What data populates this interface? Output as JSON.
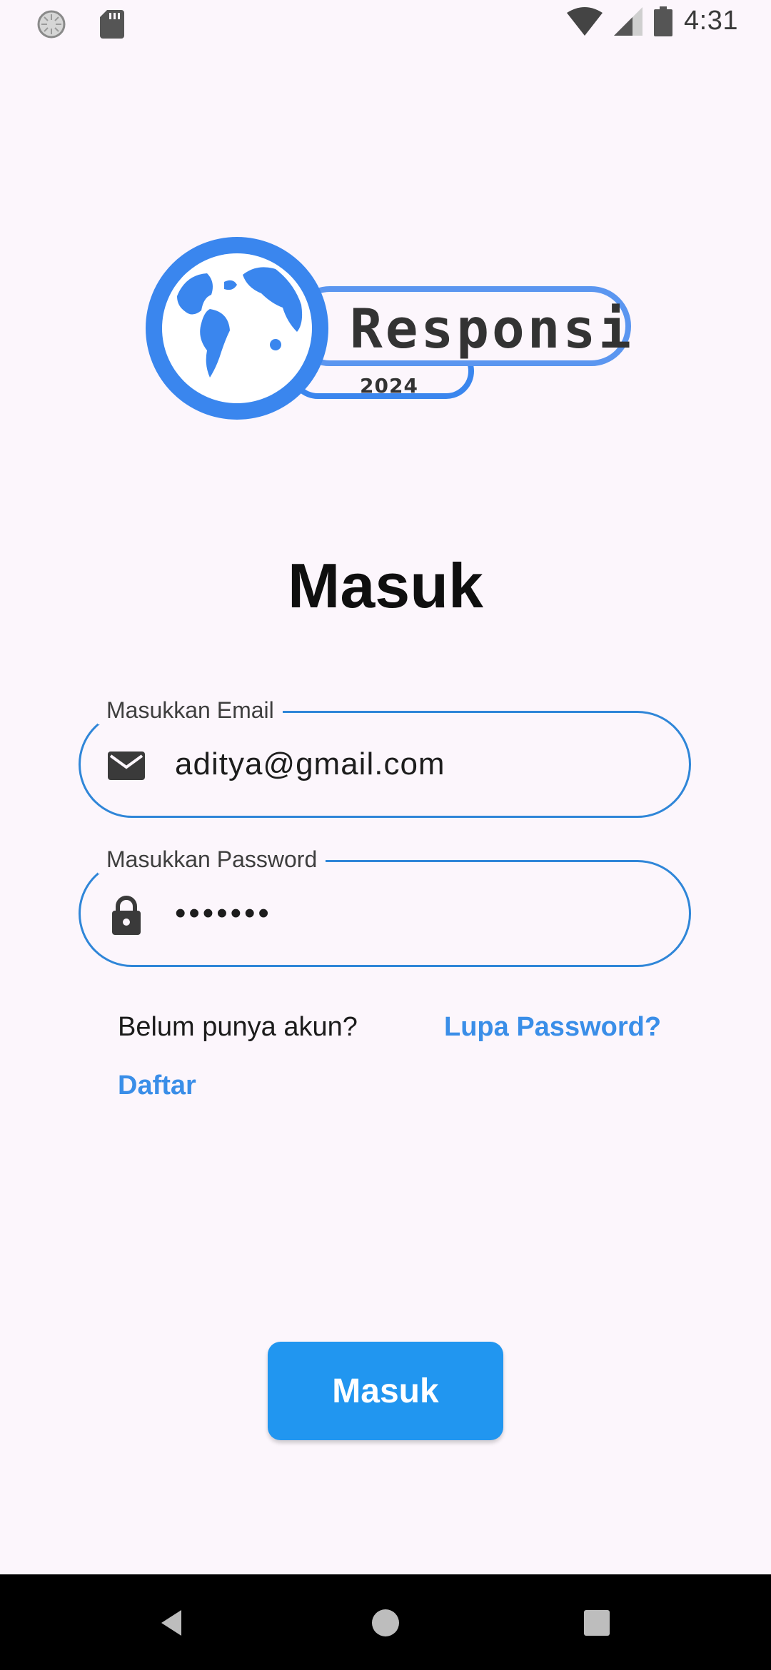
{
  "status_bar": {
    "time": "4:31",
    "icons": [
      "sync-icon",
      "sd-card-icon",
      "wifi-icon",
      "cellular-signal-icon",
      "battery-icon"
    ]
  },
  "logo": {
    "name": "Responsi",
    "year": "2024",
    "colors": {
      "primary": "#3a86ee",
      "text": "#333333"
    }
  },
  "page": {
    "title": "Masuk"
  },
  "form": {
    "email": {
      "label": "Masukkan Email",
      "value": "aditya@gmail.com",
      "icon": "mail-icon"
    },
    "password": {
      "label": "Masukkan Password",
      "value": "•••••••",
      "icon": "lock-icon"
    },
    "no_account_text": "Belum punya akun?",
    "forgot_password_link": "Lupa Password?",
    "register_link": "Daftar",
    "submit_label": "Masuk"
  },
  "colors": {
    "background": "#fcf6fc",
    "field_border": "#2f86d8",
    "link": "#3a8ee8",
    "button": "#2196f0"
  },
  "nav_bar": {
    "buttons": [
      "back-icon",
      "home-icon",
      "recent-apps-icon"
    ]
  }
}
